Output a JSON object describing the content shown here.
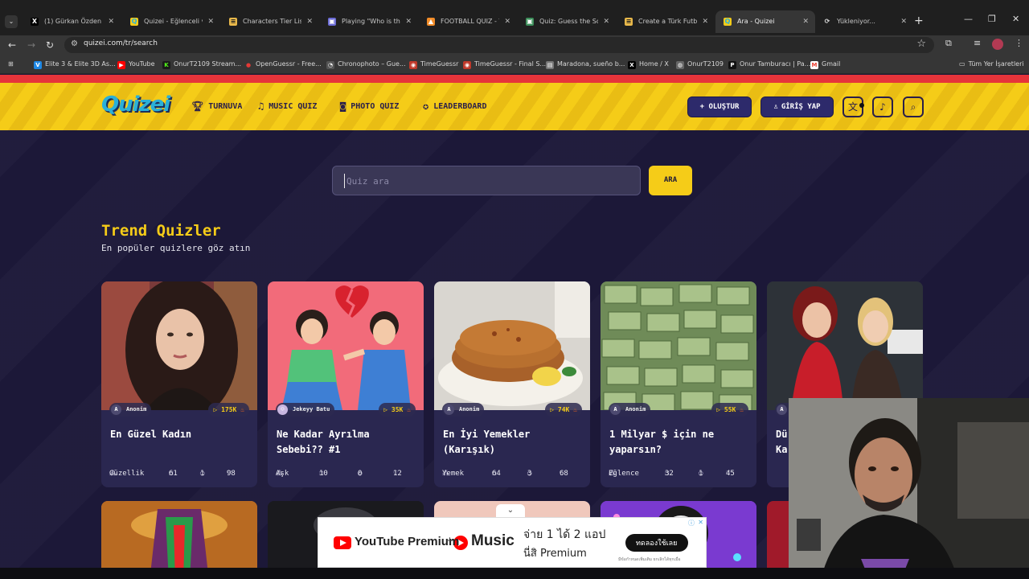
{
  "browser": {
    "tabs": [
      {
        "title": "(1) Gürkan Özden (@",
        "fav": "X",
        "favbg": "#000000",
        "favfg": "#ffffff"
      },
      {
        "title": "Quizei - Eğlenceli ve",
        "fav": "Q",
        "favbg": "#f5cc18",
        "favfg": "#2ab0d8"
      },
      {
        "title": "Characters Tier List Te",
        "fav": "≡",
        "favbg": "#e8b84a",
        "favfg": "#222222"
      },
      {
        "title": "Playing \"Who is this F",
        "fav": "▣",
        "favbg": "#6b6bd6",
        "favfg": "#ffffff"
      },
      {
        "title": "FOOTBALL QUIZ - Tri",
        "fav": "▲",
        "favbg": "#f28c28",
        "favfg": "#ffffff"
      },
      {
        "title": "Quiz: Guess the Socc",
        "fav": "▣",
        "favbg": "#3c8f5a",
        "favfg": "#ffffff"
      },
      {
        "title": "Create a Türk Futbol",
        "fav": "≡",
        "favbg": "#e8b84a",
        "favfg": "#222222"
      },
      {
        "title": "Ara - Quizei",
        "fav": "Q",
        "favbg": "#f5cc18",
        "favfg": "#2ab0d8"
      },
      {
        "title": "Yükleniyor...",
        "fav": "⟳",
        "favbg": "#1f1f1f",
        "favfg": "#dddddd"
      }
    ],
    "url": "quizei.com/tr/search",
    "bookmarks": [
      {
        "label": "Elite 3 & Elite 3D As...",
        "icon": "V",
        "color": "#1e88e5"
      },
      {
        "label": "YouTube",
        "icon": "▶",
        "color": "#ff0000"
      },
      {
        "label": "OnurT2109 Stream...",
        "icon": "K",
        "color": "#53fc18"
      },
      {
        "label": "OpenGuessr - Free...",
        "icon": "●",
        "color": "#e53935"
      },
      {
        "label": "Chronophoto – Gue...",
        "icon": "◔",
        "color": "#555555"
      },
      {
        "label": "TimeGuessr",
        "icon": "◉",
        "color": "#c0392b"
      },
      {
        "label": "TimeGuessr - Final S...",
        "icon": "◉",
        "color": "#c0392b"
      },
      {
        "label": "Maradona, sueño b...",
        "icon": "▤",
        "color": "#777777"
      },
      {
        "label": "Home / X",
        "icon": "X",
        "color": "#000000"
      },
      {
        "label": "OnurT2109",
        "icon": "◍",
        "color": "#666666"
      },
      {
        "label": "Onur Tamburacı | Pa...",
        "icon": "P",
        "color": "#111111"
      },
      {
        "label": "Gmail",
        "icon": "M",
        "color": "#ea4335"
      }
    ],
    "all_bookmarks": "Tüm Yer İşaretleri"
  },
  "header": {
    "logo": "Quizei",
    "nav": [
      {
        "label": "TURNUVA",
        "icon": "trophy-icon",
        "glyph": "🏆︎"
      },
      {
        "label": "MUSIC QUIZ",
        "icon": "music-icon",
        "glyph": "♫"
      },
      {
        "label": "PHOTO QUIZ",
        "icon": "camera-icon",
        "glyph": "◙"
      },
      {
        "label": "LEADERBOARD",
        "icon": "award-icon",
        "glyph": "✪"
      }
    ],
    "create_label": "+ OLUŞTUR",
    "login_label": "GİRİŞ YAP"
  },
  "search": {
    "placeholder": "Quiz ara",
    "button": "ARA"
  },
  "trend": {
    "title": "Trend Quizler",
    "subtitle": "En popüler quizlere göz atın",
    "cards": [
      {
        "author": "Anonim",
        "plays": "175K",
        "title": "En Güzel Kadın",
        "category": "Güzellik",
        "questions": "61",
        "comments": "1",
        "likes": "98"
      },
      {
        "author": "Jekeyy Batu",
        "plays": "35K",
        "title": "Ne Kadar Ayrılma Sebebi?? #1",
        "category": "Aşk",
        "questions": "10",
        "comments": "0",
        "likes": "12"
      },
      {
        "author": "Anonim",
        "plays": "74K",
        "title": "En İyi Yemekler (Karışık)",
        "category": "Yemek",
        "questions": "64",
        "comments": "3",
        "likes": "68"
      },
      {
        "author": "Anonim",
        "plays": "55K",
        "title": "1 Milyar $ için ne yaparsın?",
        "category": "Eğlence",
        "questions": "32",
        "comments": "1",
        "likes": "45"
      },
      {
        "author": "A",
        "plays": "",
        "title": "Dü Ka",
        "category": "",
        "questions": "",
        "comments": "",
        "likes": ""
      }
    ]
  },
  "ad": {
    "brand": "YouTube Premium",
    "plus": "+",
    "music": "Music",
    "line1": "จ่าย 1 ได้ 2 แอป",
    "line2": "นี่สิ Premium",
    "cta": "ทดลองใช้เลย",
    "fine": "มีข้อกำหนดเพิ่มเติม ยกเลิกได้ทุกเมื่อ"
  },
  "colors": {
    "accent": "#f5cc18",
    "bg": "#1c1838",
    "card": "#2a2750",
    "logo": "#2ab0d8"
  }
}
